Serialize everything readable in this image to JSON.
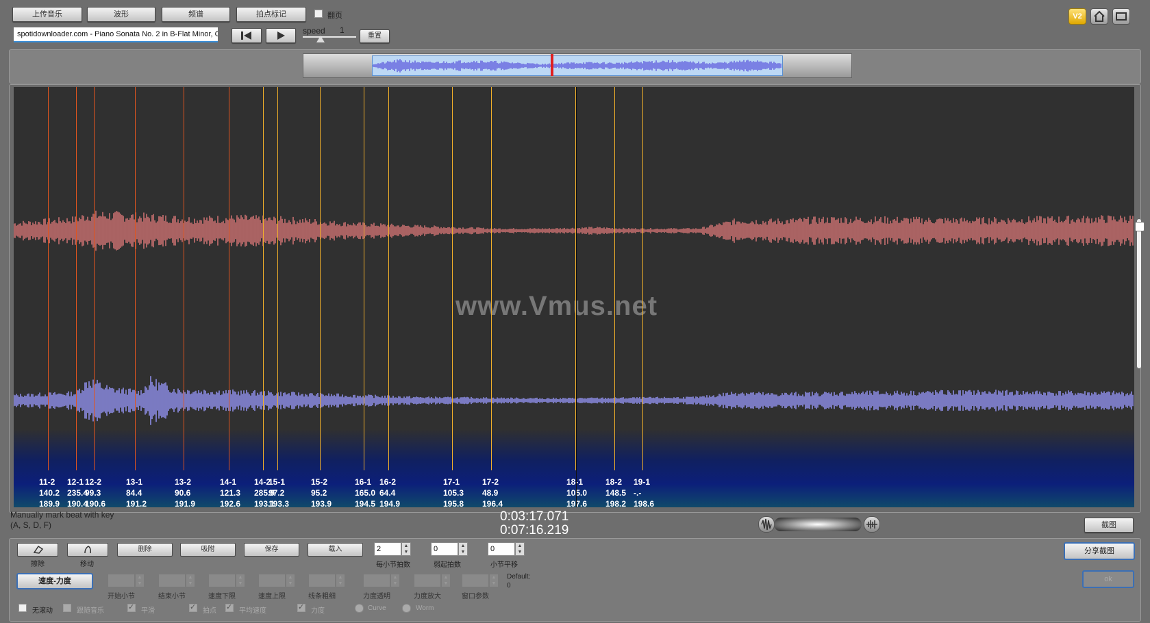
{
  "toolbar": {
    "upload_label": "上传音乐",
    "waveform_label": "波形",
    "spectrum_label": "频谱",
    "beat_mark_label": "拍点标记",
    "page_turn_label": "翻页",
    "filename_value": "spotidownloader.com - Piano Sonata No. 2 in B-Flat Minor, Op",
    "speed_label": "speed",
    "speed_value": "1",
    "reset_label": "重置",
    "v2_label": "V2"
  },
  "overview": {
    "playhead_fraction": 0.47
  },
  "main_view": {
    "watermark": "www.Vmus.net",
    "beats": [
      {
        "name": "11-2",
        "v1": "140.2",
        "v2": "189.9",
        "color": "#e0551f"
      },
      {
        "name": "12-1",
        "v1": "235.4",
        "v2": "190.4",
        "color": "#e0551f"
      },
      {
        "name": "12-2",
        "v1": "99.3",
        "v2": "190.6",
        "color": "#e0551f"
      },
      {
        "name": "13-1",
        "v1": "84.4",
        "v2": "191.2",
        "color": "#e0551f"
      },
      {
        "name": "13-2",
        "v1": "90.6",
        "v2": "191.9",
        "color": "#e0551f"
      },
      {
        "name": "14-1",
        "v1": "121.3",
        "v2": "192.6",
        "color": "#e0551f"
      },
      {
        "name": "14-2",
        "v1": "285.9",
        "v2": "193.1",
        "color": "#f2b02a"
      },
      {
        "name": "15-1",
        "v1": "97.2",
        "v2": "193.3",
        "color": "#f2b02a"
      },
      {
        "name": "15-2",
        "v1": "95.2",
        "v2": "193.9",
        "color": "#f2b02a"
      },
      {
        "name": "16-1",
        "v1": "165.0",
        "v2": "194.5",
        "color": "#f2b02a"
      },
      {
        "name": "16-2",
        "v1": "64.4",
        "v2": "194.9",
        "color": "#f2b02a"
      },
      {
        "name": "17-1",
        "v1": "105.3",
        "v2": "195.8",
        "color": "#f2b02a"
      },
      {
        "name": "17-2",
        "v1": "48.9",
        "v2": "196.4",
        "color": "#f2b02a"
      },
      {
        "name": "18-1",
        "v1": "105.0",
        "v2": "197.6",
        "color": "#f2b02a"
      },
      {
        "name": "18-2",
        "v1": "148.5",
        "v2": "198.2",
        "color": "#f2b02a"
      },
      {
        "name": "19-1",
        "v1": "-.-",
        "v2": "198.6",
        "color": "#f2b02a"
      }
    ],
    "playhead_fraction": 0.502
  },
  "status": {
    "hint_line1": "Manually mark beat with key",
    "hint_line2": "(A, S, D, F)",
    "current_time": "0:03:17.071",
    "total_time": "0:07:16.219",
    "screenshot_label": "截图"
  },
  "controls": {
    "erase_label": "擦除",
    "move_label": "移动",
    "delete_label": "删除",
    "snap_label": "吸附",
    "save_label": "保存",
    "load_label": "载入",
    "beats_per_measure_value": "2",
    "beats_per_measure_label": "每小节拍数",
    "pickup_value": "0",
    "pickup_label": "弱起拍数",
    "measure_offset_value": "0",
    "measure_offset_label": "小节平移",
    "share_label": "分享截图",
    "mode_label": "速度-力度",
    "start_measure_label": "开始小节",
    "end_measure_label": "结束小节",
    "speed_lower_label": "速度下限",
    "speed_upper_label": "速度上限",
    "line_width_label": "线条粗细",
    "dyn_transparency_label": "力度透明",
    "dyn_zoom_label": "力度放大",
    "window_param_label": "窗口参数",
    "default_label": "Default:",
    "default_value": "0",
    "ok_label": "ok",
    "no_scroll_label": "无滚动",
    "follow_music_label": "跟随音乐",
    "smooth_label": "平滑",
    "beat_point_label": "拍点",
    "avg_speed_label": "平均速度",
    "dynamics_label": "力度",
    "curve_label": "Curve",
    "worm_label": "Worm"
  }
}
